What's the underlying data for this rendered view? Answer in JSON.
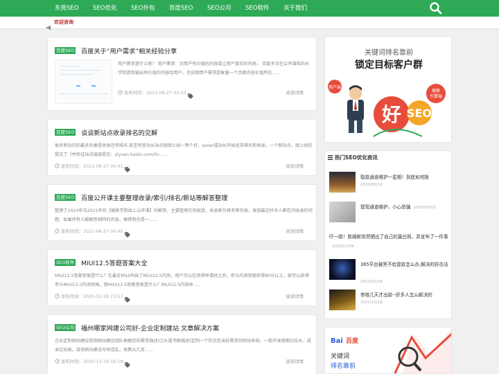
{
  "nav": {
    "items": [
      "东莞SEO",
      "SEO优化",
      "SEO外包",
      "百度SEO",
      "SEO公司",
      "SEO软件",
      "关于我们"
    ],
    "brand_color": "#2eaa57"
  },
  "notice": {
    "label": "欢迎咨询"
  },
  "posts": [
    {
      "tag": "百度SEO",
      "title": "百度关于“用户需求”相关经验分享",
      "excerpt": "用户需求是什么呢？ 用户需求：对用户有价值的内容或让用户喜欢的内容。 百度多次在公开课和站长学院提到输出有价值的内容给用户，也说明用户需求是衡量一个页面内容价值所在……",
      "date_label": "发布时间：",
      "date": "2021-08-27 00:43",
      "read_more": "阅读详情"
    },
    {
      "tag": "百度SEO",
      "title": "谈谈新站点收录排名的见解",
      "excerpt": "很多新站问的最多的便是收录还有排名,甚至有些站长站点刚刚上线一两个月，seoer或站长开始追求排名和收录。一个新站点，刚上线仅提交了《并验证站点链接提交：ziyuan.baidu.com/lin……",
      "date_label": "发布时间：",
      "date": "2021-08-27 00:41",
      "read_more": "阅读详情"
    },
    {
      "tag": "百度SEO",
      "title": "百度公开课主要整理收录/索引/排名/新站等解答整理",
      "excerpt": "整理了2020年与2021年的【搜索学院线上公开课】的解答，主要整理方向就度，收录索引排名等内容，发现最近好多人都在问收录的问题，如果所有人都解答相同的内容，搞得我也是一……",
      "date_label": "发布时间：",
      "date": "2021-08-27 00:40",
      "read_more": "阅读详情"
    },
    {
      "tag": "SEO软件",
      "title": "MIUI12.5答题答案大全",
      "excerpt": "MIUI12.5答题答案是什么？在最近MIUI开启了MIUI12.5内测，用户可以在获得申请码之后，参与内测答题获得80分以上，就可以获得参与MIUI12.5内测资格，那MIUI12.5答题答案是什么？MIUI12.5内测申……",
      "date_label": "发布时间：",
      "date": "2020-12-28 23:57",
      "read_more": "阅读详情"
    },
    {
      "tag": "SEO公司",
      "title": "福州哪家网建公司好-企业定制建站 文章解决方案",
      "excerpt": "企业定制网站建设是指网站建设团队根据您的需求描述(口头或书面描述)定制一个符合您当前需求的网站系统。一般开发周期比较长，成本比较高。目前网站建设市场混乱，收费从几百……",
      "date_label": "发布时间：",
      "date": "2020-12-19 16:18",
      "read_more": "阅读详情"
    }
  ],
  "sidebar": {
    "ad1": {
      "line1": "关键词排名靠前",
      "line2": "锁定目标客户群",
      "bubble_left": "用户端",
      "bubble_right_1": "搜索",
      "bubble_right_2": "引擎端",
      "big_char": "好",
      "seo": "SEO"
    },
    "hot": {
      "title": "热门SEO优化资讯",
      "items": [
        {
          "title": "取款通道维护一星期！到底如何挽",
          "date": "2020/05/19"
        },
        {
          "title": "提现通道维护，小心防骗",
          "date": "2020/09/19"
        },
        {
          "title": "吓一跳！詹姆斯突然晒出了自己的巢白照，并宣布了一件事",
          "date": "2020/11/06"
        },
        {
          "title": "365平台被黑不给提款怎么办,解决的好办法",
          "date": "2021/02/18"
        },
        {
          "title": "审核几天才出款--好多人怎么解决的",
          "date": "2021/10/18"
        }
      ]
    },
    "ad2": {
      "brand": "Bai",
      "brand2": "百度",
      "line1": "关键词",
      "line2": "排名靠前"
    }
  }
}
